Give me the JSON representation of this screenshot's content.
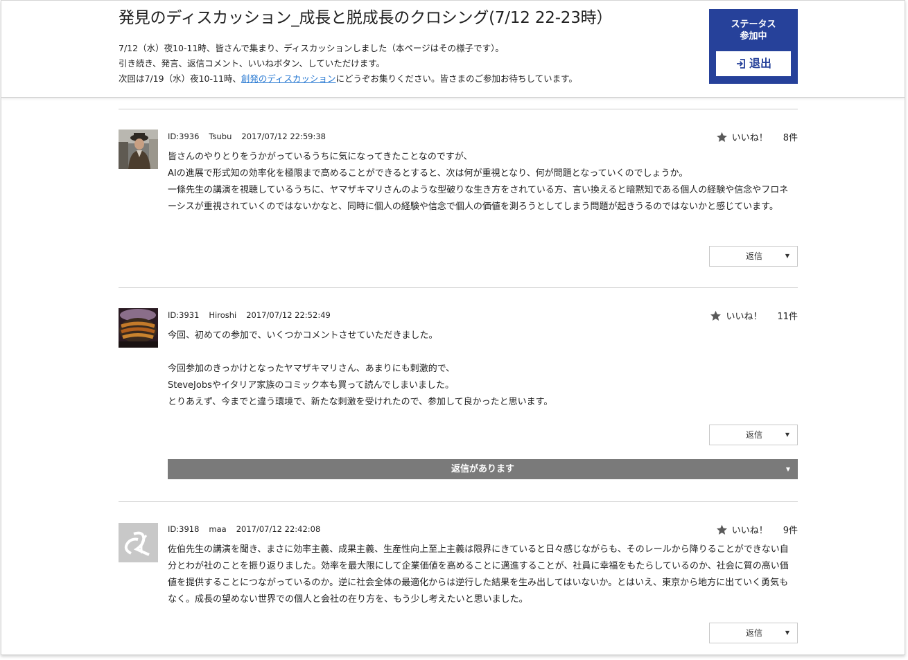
{
  "header": {
    "title": "発見のディスカッション_成長と脱成長のクロシング(7/12 22-23時）",
    "desc_line1": "7/12（水）夜10-11時、皆さんで集まり、ディスカッションしました（本ページはその様子です）。",
    "desc_line2": "引き続き、発言、返信コメント、いいねボタン、していただけます。",
    "desc_line3_prefix": "次回は7/19（水）夜10-11時、",
    "desc_line3_link": "創発のディスカッション",
    "desc_line3_suffix": "にどうぞお集りください。皆さまのご参加お待ちしています。"
  },
  "status": {
    "line1": "ステータス",
    "line2": "参加中",
    "exit_label": "退出"
  },
  "posts": [
    {
      "id": "ID:3936",
      "user": "Tsubu",
      "time": "2017/07/12 22:59:38",
      "like_label": "いいね！",
      "like_count": "8件",
      "lines": [
        "皆さんのやりとりをうかがっているうちに気になってきたことなのですが、",
        "AIの進展で形式知の効率化を極限まで高めることができるとすると、次は何が重視となり、何が問題となっていくのでしょうか。",
        "一條先生の講演を視聴しているうちに、ヤマザキマリさんのような型破りな生き方をされている方、言い換えると暗黙知である個人の経験や信念やフロネーシスが重視されていくのではないかなと、同時に個人の経験や信念で個人の価値を測ろうとしてしまう問題が起きうるのではないかと感じています。"
      ],
      "reply_label": "返信"
    },
    {
      "id": "ID:3931",
      "user": "Hiroshi",
      "time": "2017/07/12 22:52:49",
      "like_label": "いいね！",
      "like_count": "11件",
      "lines": [
        "今回、初めての参加で、いくつかコメントさせていただきました。",
        "",
        "今回参加のきっかけとなったヤマザキマリさん、あまりにも刺激的で、",
        "SteveJobsやイタリア家族のコミック本も買って読んでしまいました。",
        "とりあえず、今までと違う環境で、新たな刺激を受けれたので、参加して良かったと思います。"
      ],
      "reply_label": "返信",
      "has_replies_label": "返信があります"
    },
    {
      "id": "ID:3918",
      "user": "maa",
      "time": "2017/07/12 22:42:08",
      "like_label": "いいね！",
      "like_count": "9件",
      "lines": [
        "佐伯先生の講演を聞き、まさに効率主義、成果主義、生産性向上至上主義は限界にきていると日々感じながらも、そのレールから降りることができない自分とわが社のことを振り返りました。効率を最大限にして企業価値を高めることに邁進することが、社員に幸福をもたらしているのか、社会に質の高い価値を提供することにつながっているのか。逆に社会全体の最適化からは逆行した結果を生み出してはいないか。とはいえ、東京から地方に出ていく勇気もなく。成長の望めない世界での個人と会社の在り方を、もう少し考えたいと思いました。"
      ],
      "reply_label": "返信"
    }
  ],
  "colors": {
    "status_bg": "#26419a",
    "link": "#2a7ad2",
    "replies_bar": "#7a7a7a"
  },
  "icons": [
    "exit-icon",
    "star-icon",
    "caret-down-icon"
  ]
}
